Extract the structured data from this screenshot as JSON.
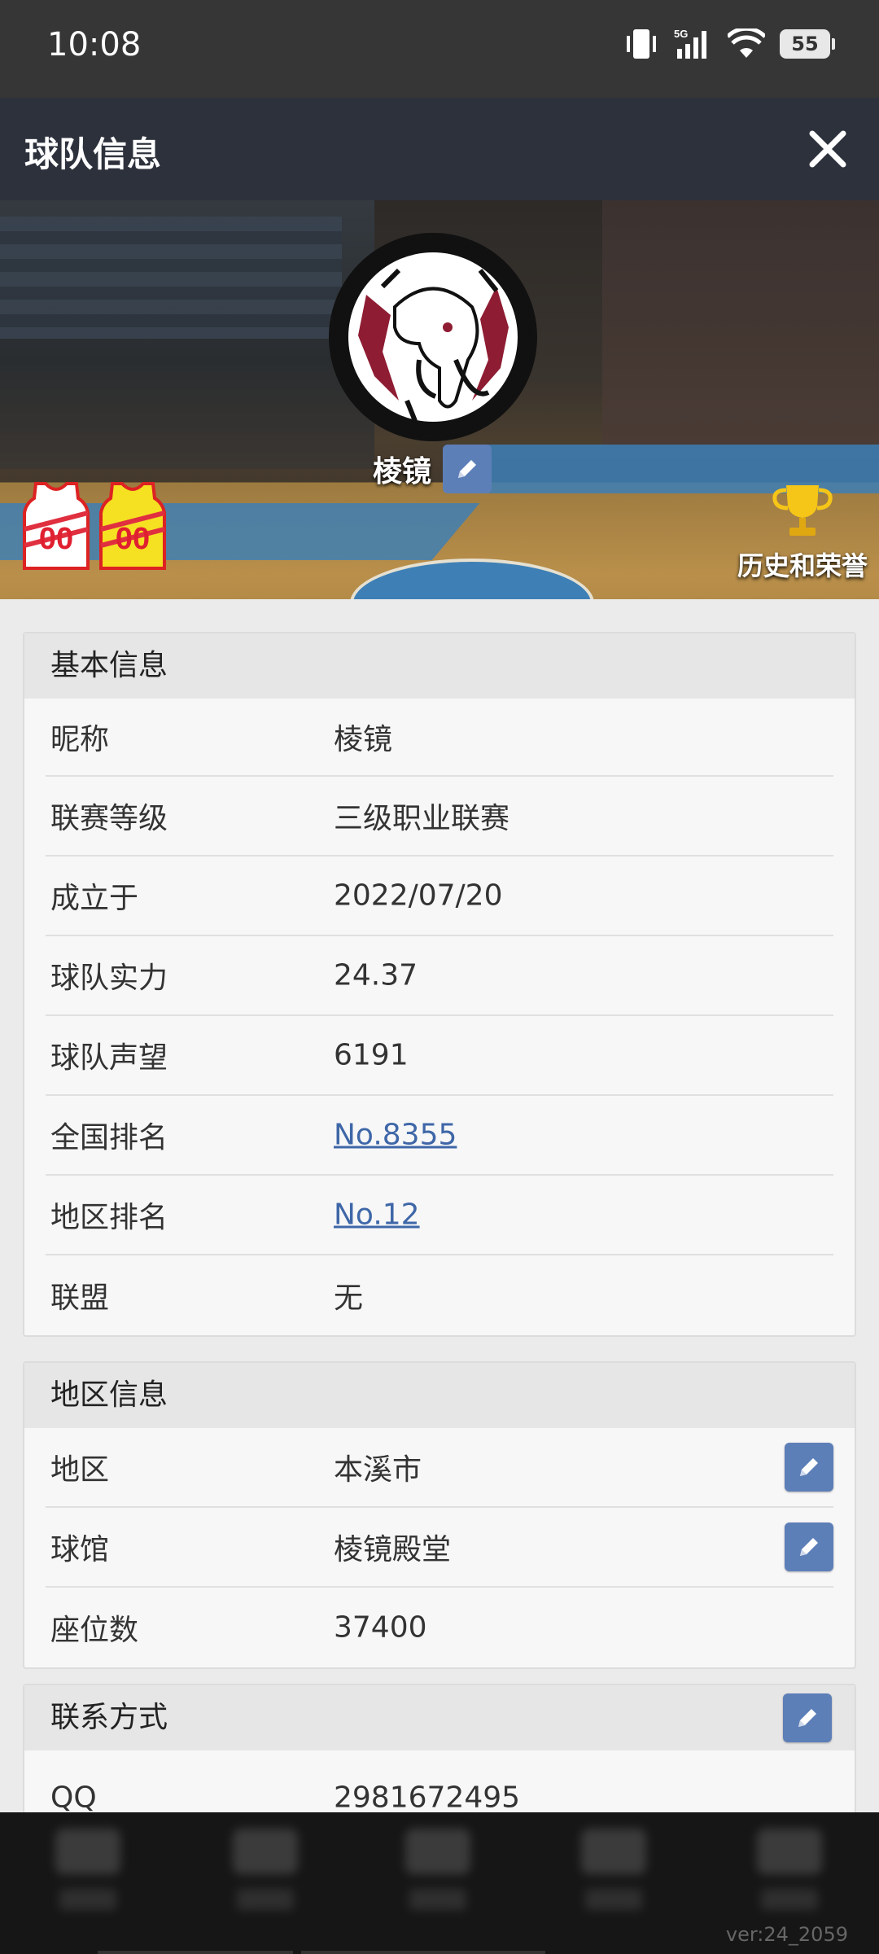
{
  "status_bar": {
    "time": "10:08",
    "battery": "55",
    "network": "5G"
  },
  "header": {
    "title": "球队信息"
  },
  "banner": {
    "team_name": "棱镜",
    "jersey_numbers": [
      "00",
      "00"
    ],
    "honor_label": "历史和荣誉"
  },
  "basic_info": {
    "title": "基本信息",
    "rows": [
      {
        "label": "昵称",
        "value": "棱镜"
      },
      {
        "label": "联赛等级",
        "value": "三级职业联赛"
      },
      {
        "label": "成立于",
        "value": "2022/07/20"
      },
      {
        "label": "球队实力",
        "value": "24.37"
      },
      {
        "label": "球队声望",
        "value": "6191"
      },
      {
        "label": "全国排名",
        "value": "No.8355"
      },
      {
        "label": "地区排名",
        "value": "No.12"
      },
      {
        "label": "联盟",
        "value": "无"
      }
    ]
  },
  "region_info": {
    "title": "地区信息",
    "rows": [
      {
        "label": "地区",
        "value": "本溪市"
      },
      {
        "label": "球馆",
        "value": "棱镜殿堂"
      },
      {
        "label": "座位数",
        "value": "37400"
      }
    ]
  },
  "contact_info": {
    "title": "联系方式",
    "rows": [
      {
        "label": "QQ",
        "value": "2981672495"
      }
    ]
  },
  "footer": {
    "version": "ver:24_2059"
  },
  "colors": {
    "header_bg": "#2d313c",
    "edit_button": "#5d7fb8",
    "link": "#3f67a8"
  }
}
